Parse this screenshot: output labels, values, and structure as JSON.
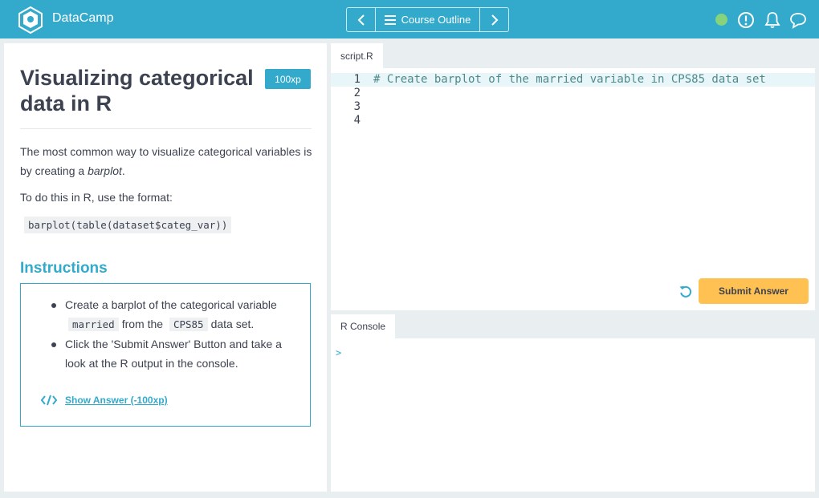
{
  "header": {
    "brand": "DataCamp",
    "nav_label": "Course Outline",
    "icons": [
      "logo-icon",
      "chevron-left-icon",
      "menu-icon",
      "chevron-right-icon",
      "status-dot",
      "alert-icon",
      "bell-icon",
      "chat-icon"
    ],
    "status_color": "#86d37b"
  },
  "exercise": {
    "title": "Visualizing categorical data in R",
    "xp": "100xp",
    "desc_lead": "The most common way to visualize categorical variables is by creating a ",
    "desc_em": "barplot",
    "desc_end": ".",
    "desc2": "To do this in R, use the format:",
    "format_code": "barplot(table(dataset$categ_var))"
  },
  "instructions": {
    "heading": "Instructions",
    "item1_pre": "Create a barplot of the categorical variable",
    "item1_code1": "married",
    "item1_mid": "from the",
    "item1_code2": "CPS85",
    "item1_post": "data set.",
    "item2": "Click the 'Submit Answer' Button and take a look at the R output in the console.",
    "show_answer": "Show Answer (-100xp)"
  },
  "editor": {
    "tab": "script.R",
    "line_numbers": "1\n2\n3\n4",
    "code": "# Create barplot of the married variable in CPS85 data set",
    "submit_label": "Submit Answer"
  },
  "console": {
    "tab": "R Console",
    "prompt": ">"
  },
  "colors": {
    "accent": "#33aacc",
    "submit": "#ffc151",
    "background": "#e9eef0"
  }
}
